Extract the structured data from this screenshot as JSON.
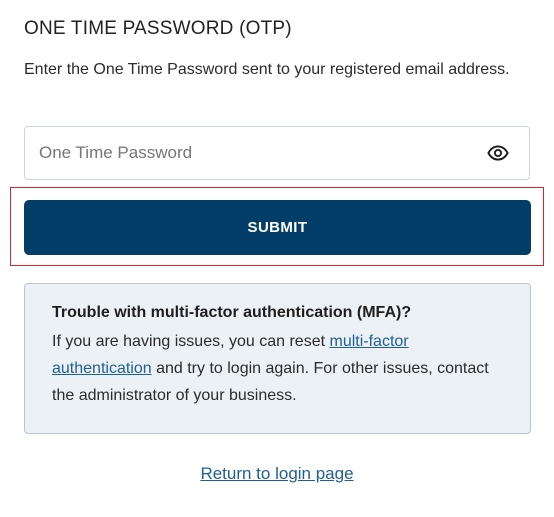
{
  "otp_section": {
    "title": "ONE TIME PASSWORD (OTP)",
    "description": "Enter the One Time Password sent to your registered email address.",
    "input_placeholder": "One Time Password",
    "input_value": "",
    "toggle_icon": "eye-icon",
    "submit_label": "SUBMIT"
  },
  "mfa_help": {
    "heading": "Trouble with multi-factor authentication (MFA)?",
    "text_before_link": "If you are having issues, you can reset ",
    "link_label": "multi-factor authentication",
    "text_after_link": " and try to login again. For other issues, contact the administrator of your business."
  },
  "footer": {
    "return_link_label": "Return to login page"
  },
  "colors": {
    "primary_button": "#033e68",
    "link": "#1f5f93",
    "info_box_bg": "#ecf1f6",
    "highlight_border": "#d9232d"
  }
}
